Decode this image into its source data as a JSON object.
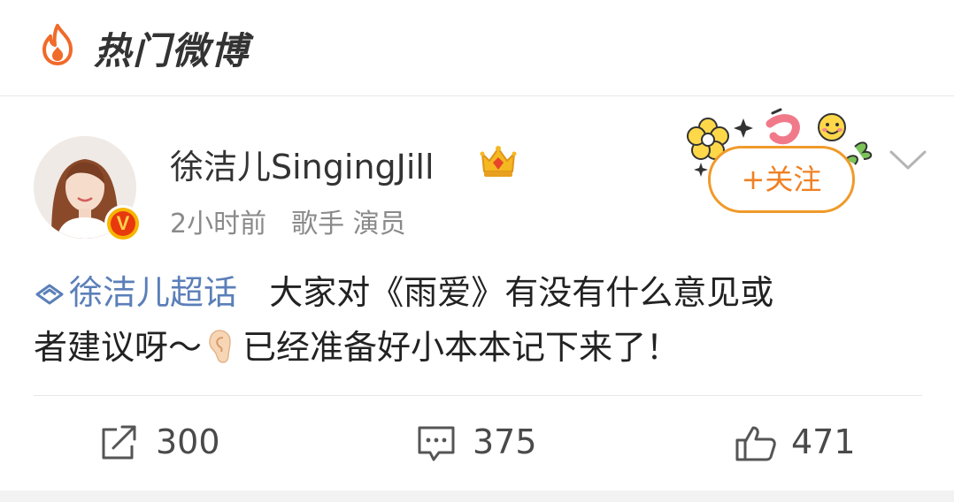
{
  "header": {
    "title": "热门微博",
    "icon": "flame-icon"
  },
  "post": {
    "author": {
      "name": "徐洁儿SingingJill",
      "verified_badge": "V",
      "member_badge_icon": "crown-icon"
    },
    "meta": {
      "time": "2小时前",
      "tags": "歌手 演员"
    },
    "follow_label": "+关注",
    "text": {
      "topic": "徐洁儿超话",
      "line1": "大家对《雨爱》有没有什么意见或",
      "line2_a": "者建议呀～",
      "line2_b": "已经准备好小本本记下来了！"
    },
    "actions": {
      "shares": "300",
      "comments": "375",
      "likes": "471"
    }
  },
  "colors": {
    "accent_orange": "#f08024",
    "topic_blue": "#5b7fb8",
    "text_dark": "#222222",
    "text_meta": "#8a8a8a"
  }
}
